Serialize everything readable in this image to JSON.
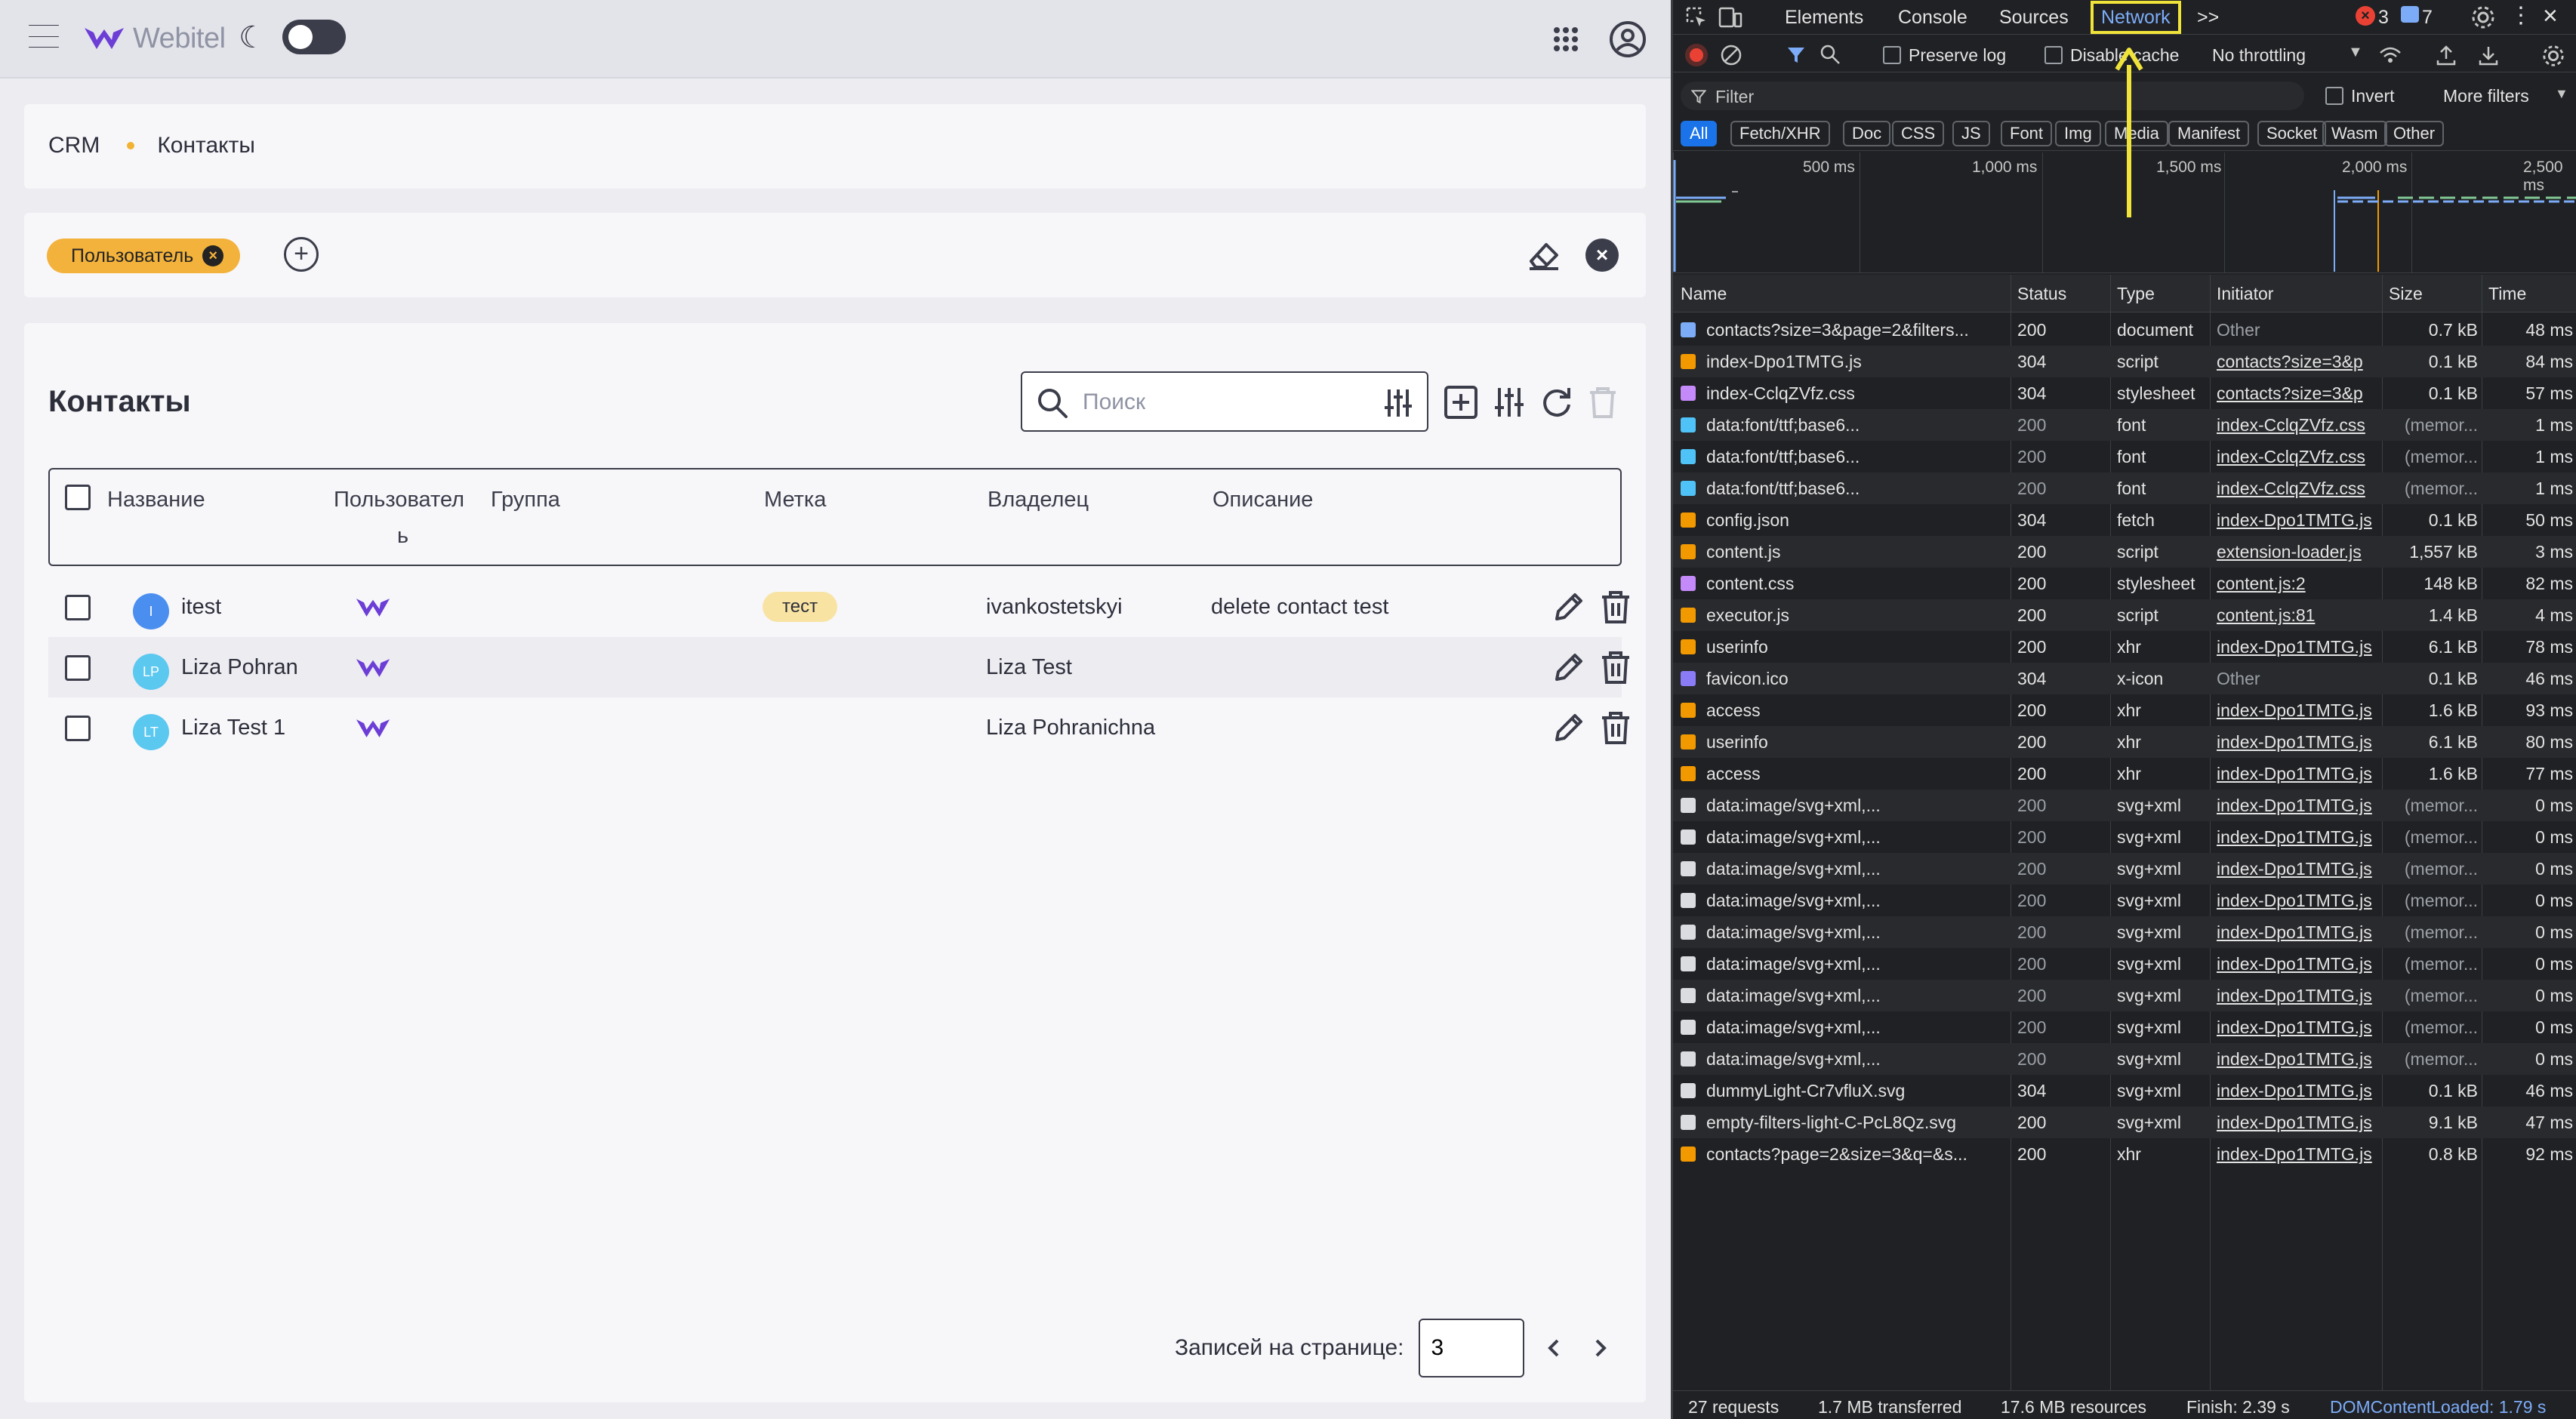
{
  "app": {
    "logo_text": "Webitel",
    "breadcrumb": {
      "root": "CRM",
      "current": "Контакты"
    },
    "filter_chip": "Пользователь",
    "contacts": {
      "title": "Контакты",
      "search_placeholder": "Поиск",
      "columns": {
        "name": "Название",
        "user": "Пользовател",
        "user_wrap": "ь",
        "group": "Группа",
        "tag": "Метка",
        "owner": "Владелец",
        "description": "Описание"
      },
      "rows": [
        {
          "initials": "I",
          "avatar_color": "#4a8ff0",
          "name": "itest",
          "tag": "тест",
          "owner": "ivankostetskyi",
          "description": "delete contact test"
        },
        {
          "initials": "LP",
          "avatar_color": "#5bc8f0",
          "name": "Liza Pohran",
          "tag": "",
          "owner": "Liza Test",
          "description": ""
        },
        {
          "initials": "LT",
          "avatar_color": "#5bc8f0",
          "name": "Liza Test 1",
          "tag": "",
          "owner": "Liza Pohranichna",
          "description": ""
        }
      ]
    },
    "pager": {
      "label": "Записей на странице:",
      "per_page": "3"
    }
  },
  "devtools": {
    "tabs": {
      "elements": "Elements",
      "console": "Console",
      "sources": "Sources",
      "network": "Network",
      "more": ">>"
    },
    "errors": "3",
    "messages": "7",
    "toolbar": {
      "preserve_log": "Preserve log",
      "disable_cache": "Disable cache",
      "throttling": "No throttling"
    },
    "filter": {
      "placeholder": "Filter",
      "invert": "Invert",
      "more_filters": "More filters"
    },
    "types": [
      "All",
      "Fetch/XHR",
      "Doc",
      "CSS",
      "JS",
      "Font",
      "Img",
      "Media",
      "Manifest",
      "Socket",
      "Wasm",
      "Other"
    ],
    "overview_ticks": [
      "500 ms",
      "1,000 ms",
      "1,500 ms",
      "2,000 ms",
      "2,500 ms"
    ],
    "columns": {
      "name": "Name",
      "status": "Status",
      "type": "Type",
      "initiator": "Initiator",
      "size": "Size",
      "time": "Time"
    },
    "requests": [
      {
        "name": "contacts?size=3&page=2&filters...",
        "status": "200",
        "type": "document",
        "initiator": "Other",
        "size": "0.7 kB",
        "time": "48 ms",
        "icon": "doc",
        "dim": false,
        "ilink": false
      },
      {
        "name": "index-Dpo1TMTG.js",
        "status": "304",
        "type": "script",
        "initiator": "contacts?size=3&p",
        "size": "0.1 kB",
        "time": "84 ms",
        "icon": "js",
        "dim": false,
        "ilink": true
      },
      {
        "name": "index-CclqZVfz.css",
        "status": "304",
        "type": "stylesheet",
        "initiator": "contacts?size=3&p",
        "size": "0.1 kB",
        "time": "57 ms",
        "icon": "css",
        "dim": false,
        "ilink": true
      },
      {
        "name": "data:font/ttf;base6...",
        "status": "200",
        "type": "font",
        "initiator": "index-CclqZVfz.css",
        "size": "(memor...",
        "time": "1 ms",
        "icon": "font",
        "dim": true,
        "ilink": true
      },
      {
        "name": "data:font/ttf;base6...",
        "status": "200",
        "type": "font",
        "initiator": "index-CclqZVfz.css",
        "size": "(memor...",
        "time": "1 ms",
        "icon": "font",
        "dim": true,
        "ilink": true
      },
      {
        "name": "data:font/ttf;base6...",
        "status": "200",
        "type": "font",
        "initiator": "index-CclqZVfz.css",
        "size": "(memor...",
        "time": "1 ms",
        "icon": "font",
        "dim": true,
        "ilink": true
      },
      {
        "name": "config.json",
        "status": "304",
        "type": "fetch",
        "initiator": "index-Dpo1TMTG.js",
        "size": "0.1 kB",
        "time": "50 ms",
        "icon": "xhr",
        "dim": false,
        "ilink": true
      },
      {
        "name": "content.js",
        "status": "200",
        "type": "script",
        "initiator": "extension-loader.js",
        "size": "1,557 kB",
        "time": "3 ms",
        "icon": "js",
        "dim": false,
        "ilink": true
      },
      {
        "name": "content.css",
        "status": "200",
        "type": "stylesheet",
        "initiator": "content.js:2",
        "size": "148 kB",
        "time": "82 ms",
        "icon": "css",
        "dim": false,
        "ilink": true
      },
      {
        "name": "executor.js",
        "status": "200",
        "type": "script",
        "initiator": "content.js:81",
        "size": "1.4 kB",
        "time": "4 ms",
        "icon": "js",
        "dim": false,
        "ilink": true
      },
      {
        "name": "userinfo",
        "status": "200",
        "type": "xhr",
        "initiator": "index-Dpo1TMTG.js",
        "size": "6.1 kB",
        "time": "78 ms",
        "icon": "xhr",
        "dim": false,
        "ilink": true
      },
      {
        "name": "favicon.ico",
        "status": "304",
        "type": "x-icon",
        "initiator": "Other",
        "size": "0.1 kB",
        "time": "46 ms",
        "icon": "ico",
        "dim": false,
        "ilink": false
      },
      {
        "name": "access",
        "status": "200",
        "type": "xhr",
        "initiator": "index-Dpo1TMTG.js",
        "size": "1.6 kB",
        "time": "93 ms",
        "icon": "xhr",
        "dim": false,
        "ilink": true
      },
      {
        "name": "userinfo",
        "status": "200",
        "type": "xhr",
        "initiator": "index-Dpo1TMTG.js",
        "size": "6.1 kB",
        "time": "80 ms",
        "icon": "xhr",
        "dim": false,
        "ilink": true
      },
      {
        "name": "access",
        "status": "200",
        "type": "xhr",
        "initiator": "index-Dpo1TMTG.js",
        "size": "1.6 kB",
        "time": "77 ms",
        "icon": "xhr",
        "dim": false,
        "ilink": true
      },
      {
        "name": "data:image/svg+xml,...",
        "status": "200",
        "type": "svg+xml",
        "initiator": "index-Dpo1TMTG.js",
        "size": "(memor...",
        "time": "0 ms",
        "icon": "img",
        "dim": true,
        "ilink": true
      },
      {
        "name": "data:image/svg+xml,...",
        "status": "200",
        "type": "svg+xml",
        "initiator": "index-Dpo1TMTG.js",
        "size": "(memor...",
        "time": "0 ms",
        "icon": "img",
        "dim": true,
        "ilink": true
      },
      {
        "name": "data:image/svg+xml,...",
        "status": "200",
        "type": "svg+xml",
        "initiator": "index-Dpo1TMTG.js",
        "size": "(memor...",
        "time": "0 ms",
        "icon": "img",
        "dim": true,
        "ilink": true
      },
      {
        "name": "data:image/svg+xml,...",
        "status": "200",
        "type": "svg+xml",
        "initiator": "index-Dpo1TMTG.js",
        "size": "(memor...",
        "time": "0 ms",
        "icon": "img",
        "dim": true,
        "ilink": true
      },
      {
        "name": "data:image/svg+xml,...",
        "status": "200",
        "type": "svg+xml",
        "initiator": "index-Dpo1TMTG.js",
        "size": "(memor...",
        "time": "0 ms",
        "icon": "img",
        "dim": true,
        "ilink": true
      },
      {
        "name": "data:image/svg+xml,...",
        "status": "200",
        "type": "svg+xml",
        "initiator": "index-Dpo1TMTG.js",
        "size": "(memor...",
        "time": "0 ms",
        "icon": "img",
        "dim": true,
        "ilink": true
      },
      {
        "name": "data:image/svg+xml,...",
        "status": "200",
        "type": "svg+xml",
        "initiator": "index-Dpo1TMTG.js",
        "size": "(memor...",
        "time": "0 ms",
        "icon": "img",
        "dim": true,
        "ilink": true
      },
      {
        "name": "data:image/svg+xml,...",
        "status": "200",
        "type": "svg+xml",
        "initiator": "index-Dpo1TMTG.js",
        "size": "(memor...",
        "time": "0 ms",
        "icon": "img",
        "dim": true,
        "ilink": true
      },
      {
        "name": "data:image/svg+xml,...",
        "status": "200",
        "type": "svg+xml",
        "initiator": "index-Dpo1TMTG.js",
        "size": "(memor...",
        "time": "0 ms",
        "icon": "img",
        "dim": true,
        "ilink": true
      },
      {
        "name": "dummyLight-Cr7vfluX.svg",
        "status": "304",
        "type": "svg+xml",
        "initiator": "index-Dpo1TMTG.js",
        "size": "0.1 kB",
        "time": "46 ms",
        "icon": "img",
        "dim": false,
        "ilink": true
      },
      {
        "name": "empty-filters-light-C-PcL8Qz.svg",
        "status": "200",
        "type": "svg+xml",
        "initiator": "index-Dpo1TMTG.js",
        "size": "9.1 kB",
        "time": "47 ms",
        "icon": "img",
        "dim": false,
        "ilink": true
      },
      {
        "name": "contacts?page=2&size=3&q=&s...",
        "status": "200",
        "type": "xhr",
        "initiator": "index-Dpo1TMTG.js",
        "size": "0.8 kB",
        "time": "92 ms",
        "icon": "xhr",
        "dim": false,
        "ilink": true
      }
    ],
    "status_bar": {
      "requests": "27 requests",
      "transferred": "1.7 MB transferred",
      "resources": "17.6 MB resources",
      "finish": "Finish: 2.39 s",
      "dcl": "DOMContentLoaded: 1.79 s"
    },
    "colors": {
      "accent": "#1a73e8",
      "highlight": "#f0e33a",
      "error": "#e94235"
    }
  }
}
